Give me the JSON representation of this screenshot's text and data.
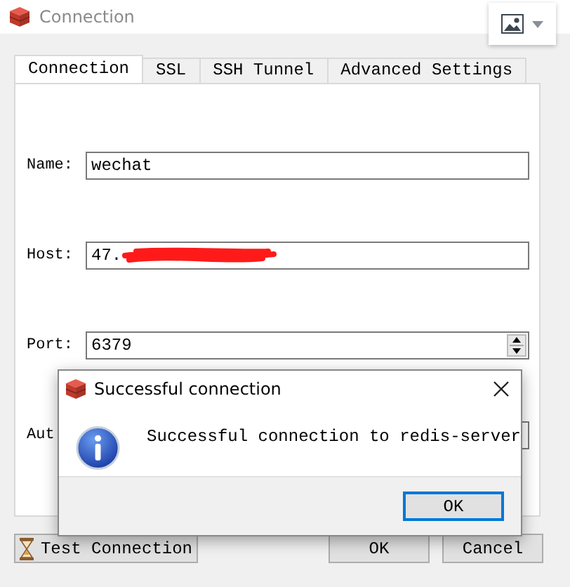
{
  "window": {
    "title": "Connection"
  },
  "tabs": [
    {
      "label": "Connection",
      "selected": true
    },
    {
      "label": "SSL",
      "selected": false
    },
    {
      "label": "SSH Tunnel",
      "selected": false
    },
    {
      "label": "Advanced Settings",
      "selected": false
    }
  ],
  "fields": [
    {
      "kind": "text",
      "label": "Name:",
      "value": "wechat"
    },
    {
      "kind": "text",
      "label": "Host:",
      "value": "47.",
      "redacted": true
    },
    {
      "kind": "spin",
      "label": "Port:",
      "value": "6379"
    },
    {
      "kind": "text",
      "label": "Aut"
    }
  ],
  "buttons": [
    {
      "label": "Test Connection",
      "kind": "test"
    },
    {
      "label": "OK",
      "kind": "plain"
    },
    {
      "label": "Cancel",
      "kind": "plain"
    }
  ],
  "dialog": {
    "title": "Successful connection",
    "message": "Successful connection to redis-server",
    "button": "OK"
  }
}
